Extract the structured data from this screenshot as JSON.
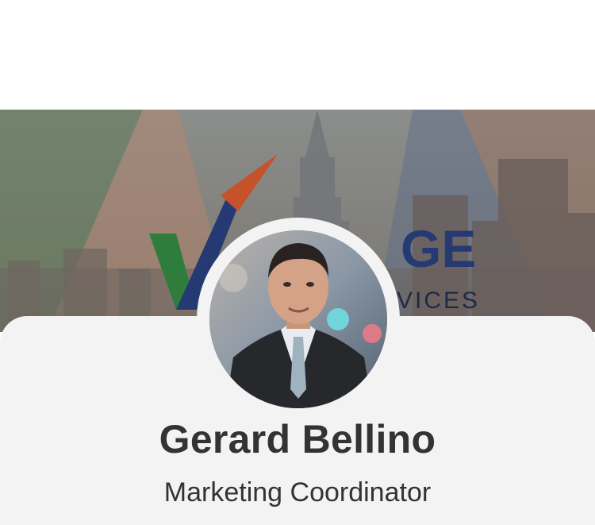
{
  "profile": {
    "name": "Gerard Bellino",
    "title": "Marketing Coordinator"
  },
  "cover": {
    "logo_text_visible": "GE",
    "logo_subtext_visible": "VICES",
    "accent_colors": [
      "#2f7d3c",
      "#c5522a",
      "#253a73"
    ]
  },
  "theme": {
    "card_background": "#f3f3f3",
    "text_color": "#333333"
  }
}
